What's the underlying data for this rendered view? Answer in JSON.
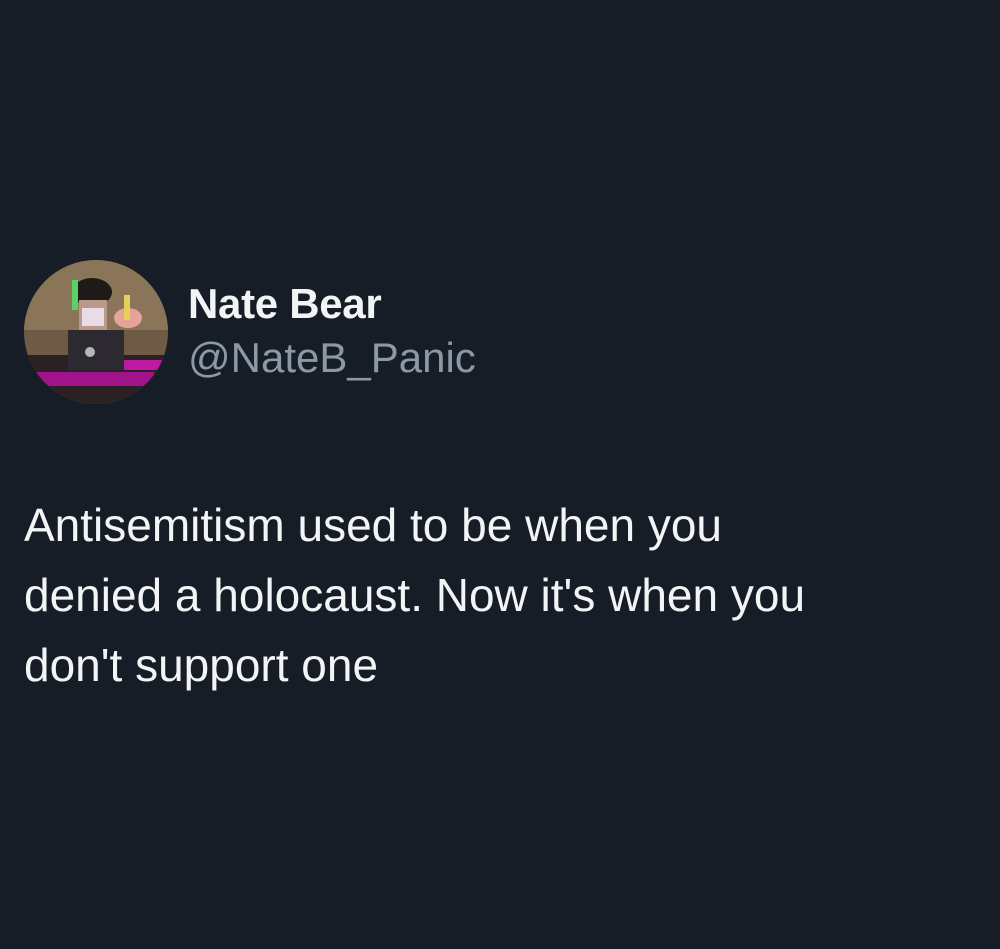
{
  "tweet": {
    "author": {
      "display_name": "Nate Bear",
      "handle": "@NateB_Panic",
      "avatar_icon": "profile-photo"
    },
    "text": "Antisemitism used to be when you\ndenied a holocaust. Now it's when you\ndon't support one"
  },
  "colors": {
    "background": "#161d26",
    "primary_text": "#f2f4f5",
    "secondary_text": "#8b98a5"
  }
}
